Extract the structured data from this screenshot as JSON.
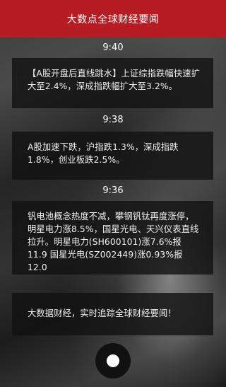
{
  "header": {
    "title": "大数点全球财经要闻"
  },
  "feed": [
    {
      "time": "9:40",
      "text": "【A股开盘后直线跳水】上证综指跌幅快速扩大至2.4%，深成指跌幅扩大至3.2%。"
    },
    {
      "time": "9:38",
      "text": "A股加速下跌，沪指跌1.3%，深成指跌1.8%，创业板跌2.5%。"
    },
    {
      "time": "9:36",
      "text": "钒电池概念热度不减，攀钢钒钛再度涨停，明星电力涨8.5%，国星光电、天兴仪表直线拉升。明星电力(SH600101)涨7.6%报11.9 国星光电(SZ002449)涨0.93%报12.0"
    }
  ],
  "footer_card": {
    "text": "大数据财经，实时追踪全球财经要闻！"
  },
  "fab": {
    "icon": "record-dot-icon"
  }
}
